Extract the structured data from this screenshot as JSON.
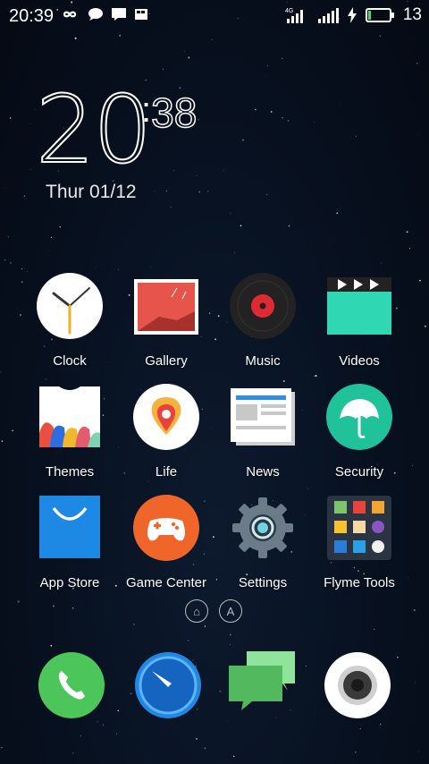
{
  "status_bar": {
    "time": "20:39",
    "network": "4G",
    "battery": "13",
    "left_icons": [
      "infinity-icon",
      "chat-bubble-icon",
      "message-icon",
      "sd-card-icon"
    ]
  },
  "clock_widget": {
    "hour": "20",
    "minute": "38",
    "date": "Thur  01/12"
  },
  "apps": [
    {
      "label": "Clock",
      "icon": "clock-icon"
    },
    {
      "label": "Gallery",
      "icon": "gallery-icon"
    },
    {
      "label": "Music",
      "icon": "music-icon"
    },
    {
      "label": "Videos",
      "icon": "videos-icon"
    },
    {
      "label": "Themes",
      "icon": "themes-icon"
    },
    {
      "label": "Life",
      "icon": "life-icon"
    },
    {
      "label": "News",
      "icon": "news-icon"
    },
    {
      "label": "Security",
      "icon": "security-icon"
    },
    {
      "label": "App Store",
      "icon": "app-store-icon"
    },
    {
      "label": "Game Center",
      "icon": "game-center-icon"
    },
    {
      "label": "Settings",
      "icon": "settings-icon"
    },
    {
      "label": "Flyme Tools",
      "icon": "flyme-tools-icon"
    }
  ],
  "page_indicator": {
    "home_glyph": "⌂",
    "a_glyph": "A"
  },
  "dock": [
    "phone-icon",
    "browser-icon",
    "messages-icon",
    "camera-icon"
  ],
  "colors": {
    "security_green": "#20c29a",
    "app_store_blue": "#1e88e5",
    "game_center_orange": "#f0652a",
    "phone_green": "#4cc55a",
    "videos_teal": "#2fd8b2"
  }
}
